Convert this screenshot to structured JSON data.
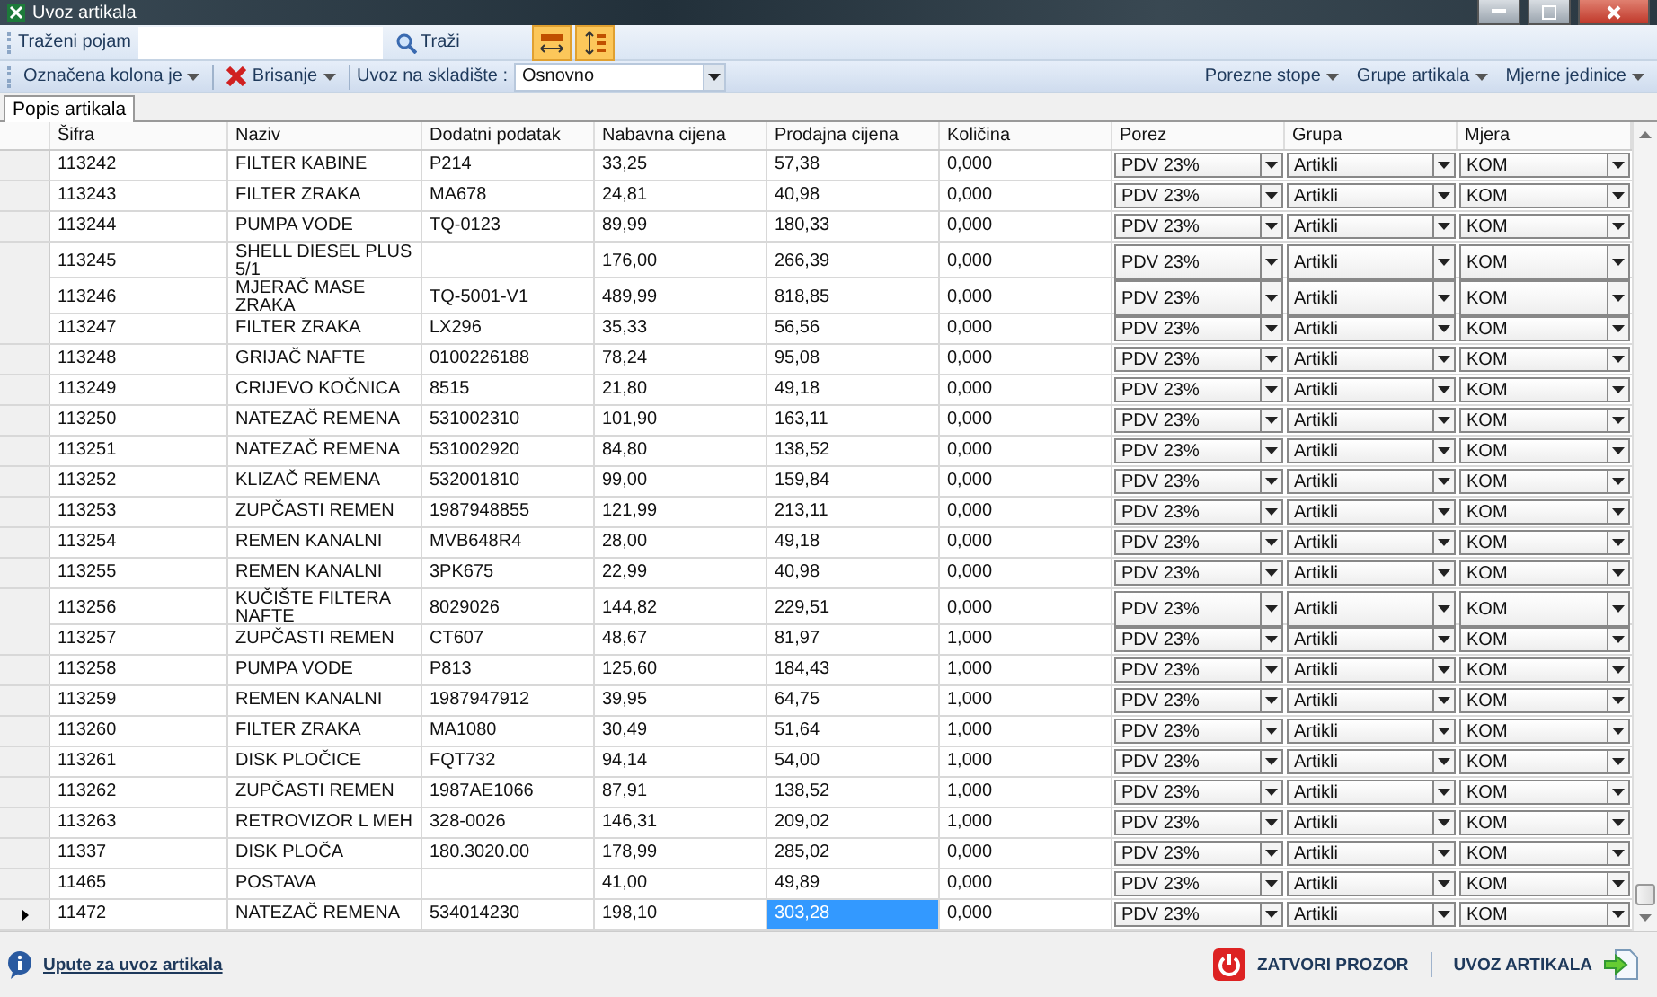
{
  "window": {
    "title": "Uvoz artikala"
  },
  "search_bar": {
    "label": "Traženi pojam",
    "button": "Traži",
    "toggles": [
      {
        "kind": "column-width",
        "on": true
      },
      {
        "kind": "row-height",
        "on": true
      }
    ]
  },
  "action_bar": {
    "left": [
      {
        "label": "Označena kolona je",
        "kind": "menu"
      },
      {
        "label": "Brisanje",
        "kind": "delete-menu"
      }
    ],
    "warehouse_label": "Uvoz na skladište :",
    "warehouse_value": "Osnovno",
    "right": [
      "Porezne stope",
      "Grupe artikala",
      "Mjerne jedinice"
    ]
  },
  "tabs": [
    {
      "label": "Popis artikala",
      "selected": true
    }
  ],
  "table": {
    "columns": [
      "Šifra",
      "Naziv",
      "Dodatni podatak",
      "Nabavna cijena",
      "Prodajna cijena",
      "Količina",
      "Porez",
      "Grupa",
      "Mjera"
    ],
    "rows": [
      {
        "sifra": "113242",
        "naziv": "FILTER KABINE",
        "dodatni": "P214",
        "nabavna": "33,25",
        "prodajna": "57,38",
        "kolicina": "0,000",
        "porez": "PDV 23%",
        "grupa": "Artikli",
        "mjera": "KOM",
        "selected": false
      },
      {
        "sifra": "113243",
        "naziv": "FILTER ZRAKA",
        "dodatni": "MA678",
        "nabavna": "24,81",
        "prodajna": "40,98",
        "kolicina": "0,000",
        "porez": "PDV 23%",
        "grupa": "Artikli",
        "mjera": "KOM",
        "selected": false
      },
      {
        "sifra": "113244",
        "naziv": "PUMPA VODE",
        "dodatni": "TQ-0123",
        "nabavna": "89,99",
        "prodajna": "180,33",
        "kolicina": "0,000",
        "porez": "PDV 23%",
        "grupa": "Artikli",
        "mjera": "KOM",
        "selected": false
      },
      {
        "sifra": "113245",
        "naziv": "SHELL DIESEL PLUS 5/1",
        "nabavna": "176,00",
        "prodajna": "266,39",
        "kolicina": "0,000",
        "porez": "PDV 23%",
        "grupa": "Artikli",
        "mjera": "KOM",
        "selected": false
      },
      {
        "sifra": "113246",
        "naziv": "MJERAČ MASE ZRAKA",
        "dodatni": "TQ-5001-V1",
        "nabavna": "489,99",
        "prodajna": "818,85",
        "kolicina": "0,000",
        "porez": "PDV 23%",
        "grupa": "Artikli",
        "mjera": "KOM",
        "selected": false
      },
      {
        "sifra": "113247",
        "naziv": "FILTER ZRAKA",
        "dodatni": "LX296",
        "nabavna": "35,33",
        "prodajna": "56,56",
        "kolicina": "0,000",
        "porez": "PDV 23%",
        "grupa": "Artikli",
        "mjera": "KOM",
        "selected": false
      },
      {
        "sifra": "113248",
        "naziv": "GRIJAČ NAFTE",
        "dodatni": "0100226188",
        "nabavna": "78,24",
        "prodajna": "95,08",
        "kolicina": "0,000",
        "porez": "PDV 23%",
        "grupa": "Artikli",
        "mjera": "KOM",
        "selected": false
      },
      {
        "sifra": "113249",
        "naziv": "CRIJEVO KOČNICA",
        "dodatni": "8515",
        "nabavna": "21,80",
        "prodajna": "49,18",
        "kolicina": "0,000",
        "porez": "PDV 23%",
        "grupa": "Artikli",
        "mjera": "KOM",
        "selected": false
      },
      {
        "sifra": "113250",
        "naziv": "NATEZAČ REMENA",
        "dodatni": "531002310",
        "nabavna": "101,90",
        "prodajna": "163,11",
        "kolicina": "0,000",
        "porez": "PDV 23%",
        "grupa": "Artikli",
        "mjera": "KOM",
        "selected": false
      },
      {
        "sifra": "113251",
        "naziv": "NATEZAČ REMENA",
        "dodatni": "531002920",
        "nabavna": "84,80",
        "prodajna": "138,52",
        "kolicina": "0,000",
        "porez": "PDV 23%",
        "grupa": "Artikli",
        "mjera": "KOM",
        "selected": false
      },
      {
        "sifra": "113252",
        "naziv": "KLIZAČ REMENA",
        "dodatni": "532001810",
        "nabavna": "99,00",
        "prodajna": "159,84",
        "kolicina": "0,000",
        "porez": "PDV 23%",
        "grupa": "Artikli",
        "mjera": "KOM",
        "selected": false
      },
      {
        "sifra": "113253",
        "naziv": "ZUPČASTI REMEN",
        "dodatni": "1987948855",
        "nabavna": "121,99",
        "prodajna": "213,11",
        "kolicina": "0,000",
        "porez": "PDV 23%",
        "grupa": "Artikli",
        "mjera": "KOM",
        "selected": false
      },
      {
        "sifra": "113254",
        "naziv": "REMEN KANALNI",
        "dodatni": "MVB648R4",
        "nabavna": "28,00",
        "prodajna": "49,18",
        "kolicina": "0,000",
        "porez": "PDV 23%",
        "grupa": "Artikli",
        "mjera": "KOM",
        "selected": false
      },
      {
        "sifra": "113255",
        "naziv": "REMEN KANALNI",
        "dodatni": "3PK675",
        "nabavna": "22,99",
        "prodajna": "40,98",
        "kolicina": "0,000",
        "porez": "PDV 23%",
        "grupa": "Artikli",
        "mjera": "KOM",
        "selected": false
      },
      {
        "sifra": "113256",
        "naziv": "KUČIŠTE FILTERA NAFTE",
        "dodatni": "8029026",
        "nabavna": "144,82",
        "prodajna": "229,51",
        "kolicina": "0,000",
        "porez": "PDV 23%",
        "grupa": "Artikli",
        "mjera": "KOM",
        "selected": false
      },
      {
        "sifra": "113257",
        "naziv": "ZUPČASTI REMEN",
        "dodatni": "CT607",
        "nabavna": "48,67",
        "prodajna": "81,97",
        "kolicina": "1,000",
        "porez": "PDV 23%",
        "grupa": "Artikli",
        "mjera": "KOM",
        "selected": false
      },
      {
        "sifra": "113258",
        "naziv": "PUMPA VODE",
        "dodatni": "P813",
        "nabavna": "125,60",
        "prodajna": "184,43",
        "kolicina": "1,000",
        "porez": "PDV 23%",
        "grupa": "Artikli",
        "mjera": "KOM",
        "selected": false
      },
      {
        "sifra": "113259",
        "naziv": "REMEN KANALNI",
        "dodatni": "1987947912",
        "nabavna": "39,95",
        "prodajna": "64,75",
        "kolicina": "1,000",
        "porez": "PDV 23%",
        "grupa": "Artikli",
        "mjera": "KOM",
        "selected": false
      },
      {
        "sifra": "113260",
        "naziv": "FILTER ZRAKA",
        "dodatni": "MA1080",
        "nabavna": "30,49",
        "prodajna": "51,64",
        "kolicina": "1,000",
        "porez": "PDV 23%",
        "grupa": "Artikli",
        "mjera": "KOM",
        "selected": false
      },
      {
        "sifra": "113261",
        "naziv": "DISK PLOČICE",
        "dodatni": "FQT732",
        "nabavna": "94,14",
        "prodajna": "54,00",
        "kolicina": "1,000",
        "porez": "PDV 23%",
        "grupa": "Artikli",
        "mjera": "KOM",
        "selected": false
      },
      {
        "sifra": "113262",
        "naziv": "ZUPČASTI REMEN",
        "dodatni": "1987AE1066",
        "nabavna": "87,91",
        "prodajna": "138,52",
        "kolicina": "1,000",
        "porez": "PDV 23%",
        "grupa": "Artikli",
        "mjera": "KOM",
        "selected": false
      },
      {
        "sifra": "113263",
        "naziv": "RETROVIZOR L MEH",
        "dodatni": "328-0026",
        "nabavna": "146,31",
        "prodajna": "209,02",
        "kolicina": "1,000",
        "porez": "PDV 23%",
        "grupa": "Artikli",
        "mjera": "KOM",
        "selected": false
      },
      {
        "sifra": "11337",
        "naziv": "DISK PLOČA",
        "dodatni": "180.3020.00",
        "nabavna": "178,99",
        "prodajna": "285,02",
        "kolicina": "0,000",
        "porez": "PDV 23%",
        "grupa": "Artikli",
        "mjera": "KOM",
        "selected": false
      },
      {
        "sifra": "11465",
        "naziv": "POSTAVA",
        "nabavna": "41,00",
        "prodajna": "49,89",
        "kolicina": "0,000",
        "porez": "PDV 23%",
        "grupa": "Artikli",
        "mjera": "KOM",
        "selected": false
      },
      {
        "sifra": "11472",
        "naziv": "NATEZAČ REMENA",
        "dodatni": "534014230",
        "nabavna": "198,10",
        "prodajna": "303,28",
        "kolicina": "0,000",
        "porez": "PDV 23%",
        "grupa": "Artikli",
        "mjera": "KOM",
        "selected": true
      }
    ]
  },
  "footer": {
    "help_link": "Upute za uvoz artikala",
    "buttons": [
      {
        "label": "ZATVORI PROZOR",
        "kind": "close"
      },
      {
        "label": "UVOZ ARTIKALA",
        "kind": "import"
      }
    ]
  }
}
